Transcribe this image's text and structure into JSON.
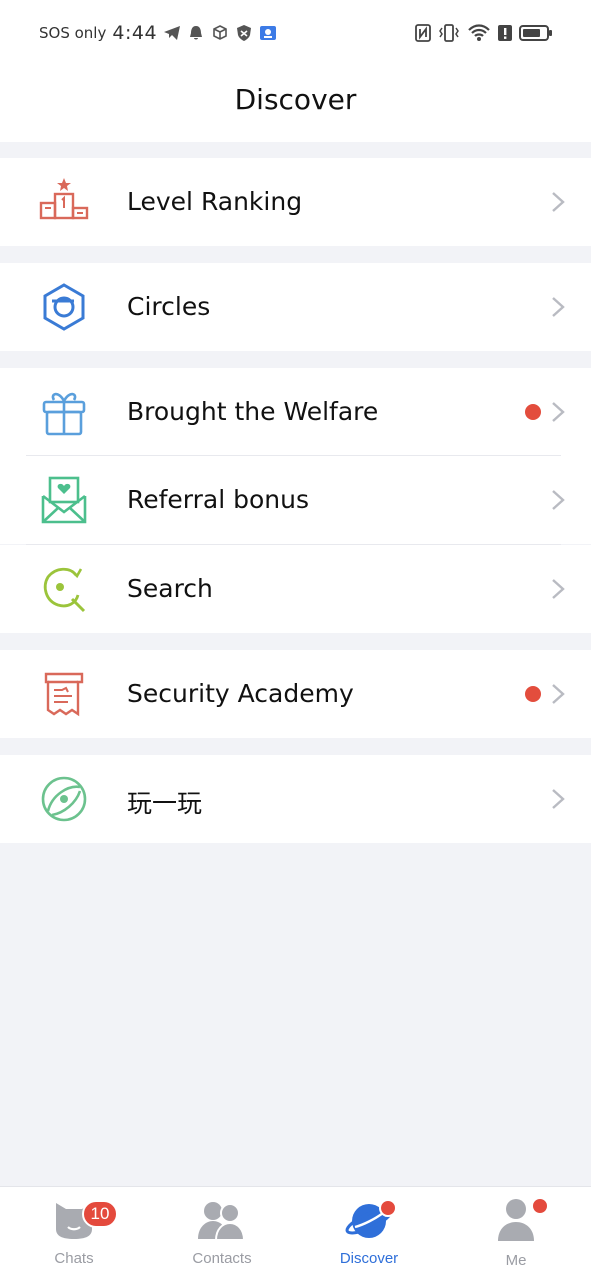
{
  "status_bar": {
    "carrier": "SOS only",
    "time": "4:44",
    "left_icons": [
      "telegram-icon",
      "bell-icon",
      "cube-icon",
      "shield-icon",
      "app-notification-icon"
    ],
    "right_icons": [
      "nfc-icon",
      "vibrate-icon",
      "wifi-icon",
      "alert-icon",
      "battery-icon"
    ]
  },
  "header": {
    "title": "Discover"
  },
  "sections": [
    {
      "items": [
        {
          "icon": "podium-icon",
          "label": "Level Ranking",
          "dot": false
        }
      ]
    },
    {
      "items": [
        {
          "icon": "hexagon-icon",
          "label": "Circles",
          "dot": false
        }
      ]
    },
    {
      "items": [
        {
          "icon": "gift-icon",
          "label": "Brought the Welfare",
          "dot": true
        },
        {
          "icon": "envelope-heart-icon",
          "label": "Referral bonus",
          "dot": false
        },
        {
          "icon": "search-refresh-icon",
          "label": "Search",
          "dot": false
        }
      ]
    },
    {
      "items": [
        {
          "icon": "scroll-icon",
          "label": "Security Academy",
          "dot": true
        }
      ]
    },
    {
      "items": [
        {
          "icon": "play-disc-icon",
          "label": "玩一玩",
          "dot": false
        }
      ]
    }
  ],
  "bottom_nav": {
    "tabs": [
      {
        "label": "Chats",
        "icon": "chat-cat-icon",
        "badge": "10",
        "active": false
      },
      {
        "label": "Contacts",
        "icon": "contacts-icon",
        "badge": "",
        "active": false
      },
      {
        "label": "Discover",
        "icon": "planet-icon",
        "badge": "",
        "active": true
      },
      {
        "label": "Me",
        "icon": "person-icon",
        "badge": "",
        "active": false
      }
    ]
  },
  "colors": {
    "accent": "#2f6fd9",
    "badge_red": "#e44a3d",
    "background": "#f2f3f7",
    "tab_inactive": "#9a9ca3"
  }
}
